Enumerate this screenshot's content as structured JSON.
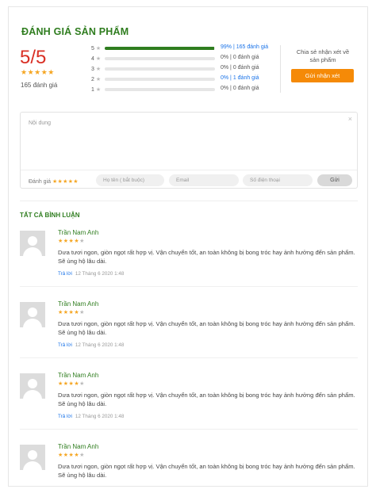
{
  "review": {
    "title": "ĐÁNH GIÁ SẢN PHẨM",
    "score": "5/5",
    "score_stars": "★★★★★",
    "total": "165 đánh giá",
    "bars": [
      {
        "label": "5",
        "percent": 99,
        "text": "99% | 165 đánh giá",
        "highlight": true
      },
      {
        "label": "4",
        "percent": 0,
        "text": "0% | 0 đánh giá",
        "highlight": false
      },
      {
        "label": "3",
        "percent": 0,
        "text": "0% | 0 đánh giá",
        "highlight": false
      },
      {
        "label": "2",
        "percent": 0,
        "text": "0% | 1 đánh giá",
        "highlight": true
      },
      {
        "label": "1",
        "percent": 0,
        "text": "0% | 0 đánh giá",
        "highlight": false
      }
    ],
    "share_text": "Chia sẻ nhận xét về sản phẩm",
    "share_button": "Gửi nhận xét"
  },
  "form": {
    "content_placeholder": "Nội dung",
    "close": "×",
    "rate_label": "Đánh giá",
    "rate_stars": "★★★★★",
    "name_placeholder": "Họ tên ( bắt buộc)",
    "email_placeholder": "Email",
    "phone_placeholder": "Số điện thoại",
    "send": "Gửi"
  },
  "comments": {
    "title": "TẤT CẢ BÌNH LUẬN",
    "items": [
      {
        "name": "Trần Nam Anh",
        "stars_on": "★★★★",
        "stars_off": "★",
        "text": "Dưa tươi ngon, giòn ngọt rất hợp vị. Vận chuyển tốt, an toàn không bị bong tróc hay ảnh hưởng đến sản phẩm. Sẽ ủng hộ lâu dài.",
        "reply": "Trả lời",
        "time": "12 Tháng 6 2020 1:48"
      },
      {
        "name": "Trần Nam Anh",
        "stars_on": "★★★★",
        "stars_off": "★",
        "text": "Dưa tươi ngon, giòn ngọt rất hợp vị. Vận chuyển tốt, an toàn không bị bong tróc hay ảnh hưởng đến sản phẩm. Sẽ ủng hộ lâu dài.",
        "reply": "Trả lời",
        "time": "12 Tháng 6 2020 1:48"
      },
      {
        "name": "Trần Nam Anh",
        "stars_on": "★★★★",
        "stars_off": "★",
        "text": "Dưa tươi ngon, giòn ngọt rất hợp vị. Vận chuyển tốt, an toàn không bị bong tróc hay ảnh hưởng đến sản phẩm. Sẽ ủng hộ lâu dài.",
        "reply": "Trả lời",
        "time": "12 Tháng 6 2020 1:48"
      },
      {
        "name": "Trần Nam Anh",
        "stars_on": "★★★★",
        "stars_off": "★",
        "text": "Dưa tươi ngon, giòn ngọt rất hợp vị. Vận chuyển tốt, an toàn không bị bong tróc hay ảnh hưởng đến sản phẩm. Sẽ ủng hộ lâu dài.",
        "reply": "",
        "time": ""
      }
    ]
  }
}
